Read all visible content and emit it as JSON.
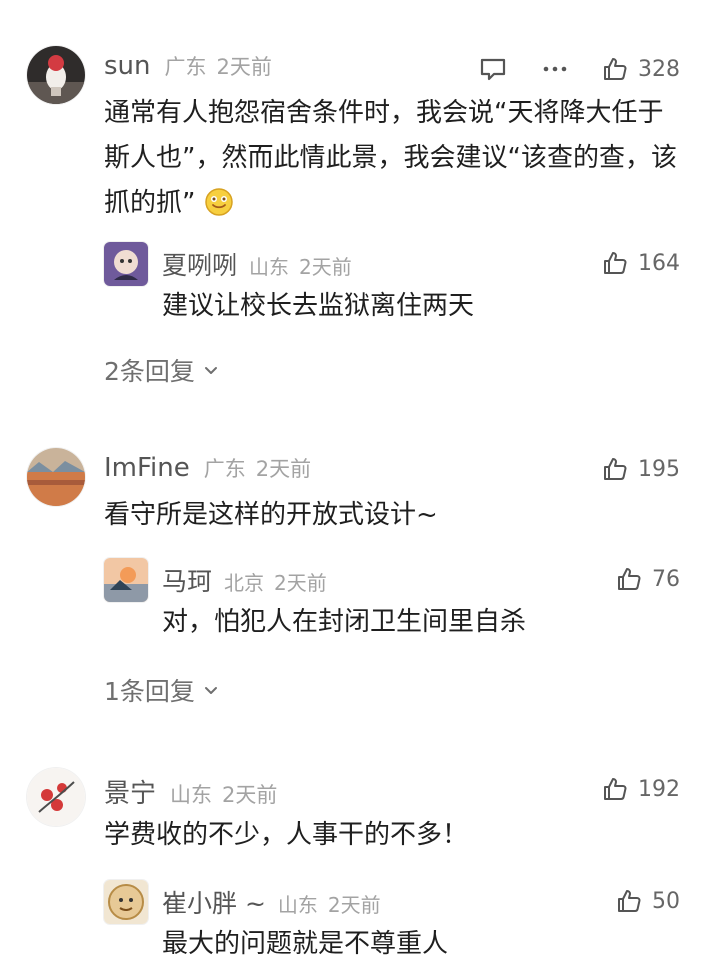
{
  "comments": [
    {
      "username": "sun",
      "location": "广东",
      "time": "2天前",
      "likes": "328",
      "text": "通常有人抱怨宿舍条件时，我会说“天将降大任于斯人也”，然而此情此景，我会建议“该查的查，该抓的抓”",
      "reply": {
        "username": "夏咧咧",
        "location": "山东",
        "time": "2天前",
        "likes": "164",
        "text": "建议让校长去监狱离住两天"
      },
      "more_replies": "2条回复"
    },
    {
      "username": "ImFine",
      "location": "广东",
      "time": "2天前",
      "likes": "195",
      "text": "看守所是这样的开放式设计~",
      "reply": {
        "username": "马珂",
        "location": "北京",
        "time": "2天前",
        "likes": "76",
        "text": "对，怕犯人在封闭卫生间里自杀"
      },
      "more_replies": "1条回复"
    },
    {
      "username": "景宁",
      "location": "山东",
      "time": "2天前",
      "likes": "192",
      "text": "学费收的不少，人事干的不多！",
      "reply": {
        "username": "崔小胖 ~",
        "location": "山东",
        "time": "2天前",
        "likes": "50",
        "text": "最大的问题就是不尊重人"
      }
    }
  ],
  "icons": {
    "like": "thumbs-up-icon",
    "message": "message-icon",
    "more": "more-icon",
    "chevron": "chevron-down-icon",
    "emoji": "smile-emoji-icon"
  }
}
